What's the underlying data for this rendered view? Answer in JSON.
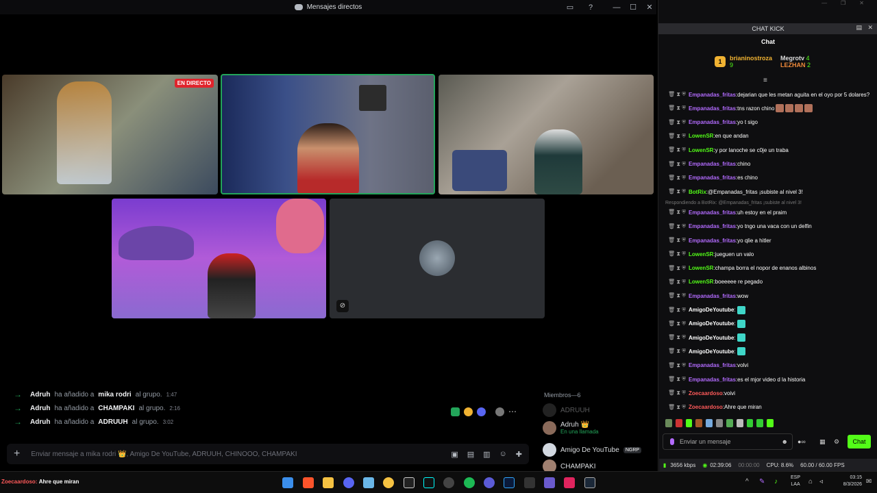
{
  "discord": {
    "title": "Mensajes directos",
    "live_badge": "EN DIRECTO",
    "system_messages": [
      {
        "actor": "Adruh",
        "mid": "ha añadido a",
        "target": "mika rodri",
        "tail": "al grupo.",
        "time": "1:47"
      },
      {
        "actor": "Adruh",
        "mid": "ha añadido a",
        "target": "CHAMPAKI",
        "tail": "al grupo.",
        "time": "2:16"
      },
      {
        "actor": "Adruh",
        "mid": "ha añadido a",
        "target": "ADRUUH",
        "tail": "al grupo.",
        "time": "3:02"
      }
    ],
    "message_placeholder": "Enviar mensaje a mika rodri 👑, Amigo De YouTube, ADRUUH, CHINOOO, CHAMPAKI",
    "members_header": "Miembros—6",
    "members": [
      {
        "name": "ADRUUH",
        "sub": "",
        "tag": ""
      },
      {
        "name": "Adruh 👑",
        "sub": "En una llamada",
        "tag": ""
      },
      {
        "name": "Amigo De YouTube",
        "sub": "",
        "tag": "NGRP"
      },
      {
        "name": "CHAMPAKI",
        "sub": "",
        "tag": ""
      }
    ]
  },
  "kick": {
    "window_title": "CHAT KICK",
    "tab": "Chat",
    "leaderboard": [
      {
        "rank": "1",
        "name": "brianinostroza",
        "count": "9"
      },
      {
        "name": "Megrotv",
        "count": "4"
      },
      {
        "name": "LEZHAN",
        "count": "2"
      }
    ],
    "messages": [
      {
        "user": "Empanadas_fritas",
        "color": "#b36bff",
        "text": "dejarian que les metan aguita en el oyo por 5 dolares?"
      },
      {
        "user": "Empanadas_fritas",
        "color": "#b36bff",
        "text": "tns razon chino"
      },
      {
        "user": "Empanadas_fritas",
        "color": "#b36bff",
        "text": "yo t sigo"
      },
      {
        "user": "LowenSR",
        "color": "#53fc18",
        "text": "en que andan"
      },
      {
        "user": "LowenSR",
        "color": "#53fc18",
        "text": "y por lanoche se c0je un traba"
      },
      {
        "user": "Empanadas_fritas",
        "color": "#b36bff",
        "text": "chino"
      },
      {
        "user": "Empanadas_fritas",
        "color": "#b36bff",
        "text": "es chino"
      },
      {
        "user": "BotRix",
        "color": "#53fc18",
        "text": "@Empanadas_fritas ¡subiste al nivel 3!"
      },
      {
        "user": "Empanadas_fritas",
        "color": "#b36bff",
        "text": "uh estoy en el praim"
      },
      {
        "user": "Empanadas_fritas",
        "color": "#b36bff",
        "text": "yo tngo una vaca con un delfin"
      },
      {
        "user": "Empanadas_fritas",
        "color": "#b36bff",
        "text": "yo qlie a hitler"
      },
      {
        "user": "LowenSR",
        "color": "#53fc18",
        "text": "jueguen un valo"
      },
      {
        "user": "LowenSR",
        "color": "#53fc18",
        "text": "champa borra el nopor de enanos albinos"
      },
      {
        "user": "LowenSR",
        "color": "#53fc18",
        "text": "boeeeee re pegado"
      },
      {
        "user": "Empanadas_fritas",
        "color": "#b36bff",
        "text": "wow"
      },
      {
        "user": "AmigoDeYoutube",
        "color": "#ffffff",
        "text": ""
      },
      {
        "user": "AmigoDeYoutube",
        "color": "#ffffff",
        "text": ""
      },
      {
        "user": "AmigoDeYoutube",
        "color": "#ffffff",
        "text": ""
      },
      {
        "user": "AmigoDeYoutube",
        "color": "#ffffff",
        "text": ""
      },
      {
        "user": "Empanadas_fritas",
        "color": "#b36bff",
        "text": "volvi"
      },
      {
        "user": "Empanadas_fritas",
        "color": "#b36bff",
        "text": "es el mjor video d la historia"
      },
      {
        "user": "Zoecaardoso",
        "color": "#ff5a5a",
        "text": "voivi"
      },
      {
        "user": "Zoecaardoso",
        "color": "#ff5a5a",
        "text": "Ahre que miran"
      }
    ],
    "reply_note": "Respondiendo a BotRix: @Empanadas_fritas ¡subiste al nivel 3!",
    "input_placeholder": "Enviar un mensaje",
    "chat_button": "Chat"
  },
  "status_bar": {
    "bitrate": "3656 kbps",
    "time": "02:39:06",
    "time2": "00:00:00",
    "cpu": "CPU: 8.6%",
    "fps": "60.00 / 60.00 FPS"
  },
  "taskbar": {
    "overlay_user": "Zoecaardoso:",
    "overlay_text": "Ahre que miran",
    "lang1": "ESP",
    "lang2": "LAA",
    "clock": "03:15",
    "date": "8/3/2026"
  },
  "colors": {
    "kick_green": "#53fc18",
    "discord_green": "#23a55a",
    "live_red": "#e0242c"
  }
}
